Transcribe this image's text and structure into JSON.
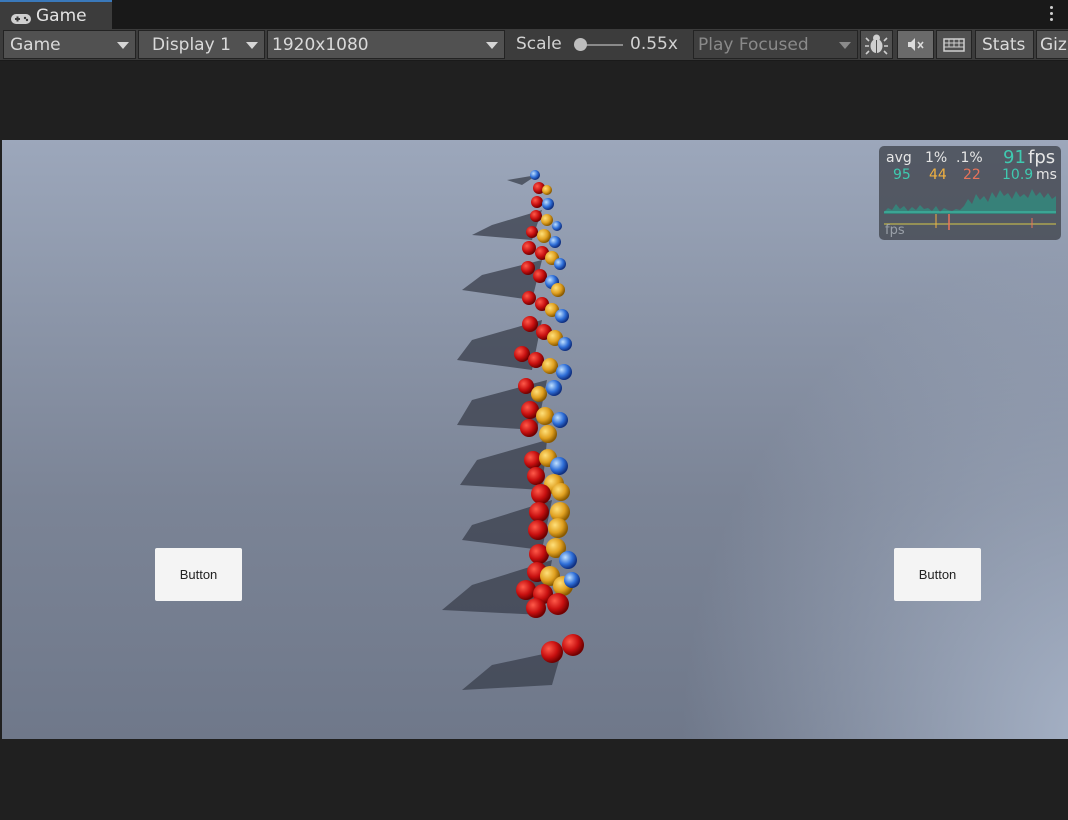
{
  "tab": {
    "label": "Game",
    "icon": "gamepad-icon"
  },
  "toolbar": {
    "mode": "Game",
    "display": "Display 1",
    "resolution": "1920x1080",
    "scale_label": "Scale",
    "scale_value": "0.55x",
    "play_mode": "Play Focused",
    "stats": "Stats",
    "gizmos": "Giz"
  },
  "game": {
    "left_button": "Button",
    "right_button": "Button",
    "fps_panel": {
      "avg_label": "avg",
      "p1_label": "1%",
      "p01_label": ".1%",
      "fps_value": "91",
      "fps_unit": "fps",
      "avg_value": "95",
      "p1_value": "44",
      "p01_value": "22",
      "ms_value": "10.9",
      "ms_unit": "ms",
      "graph_label": "fps"
    }
  },
  "colors": {
    "accent": "#3a79bb",
    "teal": "#3fc9b0",
    "orange": "#f0b040",
    "red": "#e8735a"
  }
}
